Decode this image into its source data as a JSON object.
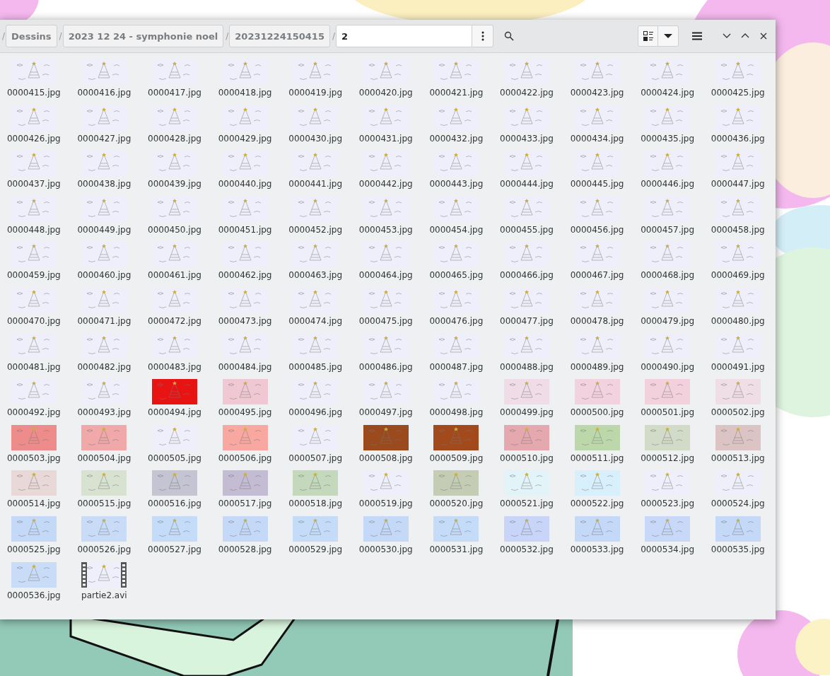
{
  "path": [
    {
      "separator": "/",
      "label": "Dessins",
      "selected": false
    },
    {
      "separator": "/",
      "label": "2023 12 24 - symphonie noel",
      "selected": false
    },
    {
      "separator": "/",
      "label": "20231224150415",
      "selected": false
    },
    {
      "separator": "/",
      "label": "2",
      "selected": true
    }
  ],
  "files": [
    {
      "name": "0000415.jpg",
      "kind": "image",
      "color": "#efeffb"
    },
    {
      "name": "0000416.jpg",
      "kind": "image",
      "color": "#efeffb"
    },
    {
      "name": "0000417.jpg",
      "kind": "image",
      "color": "#efeffb"
    },
    {
      "name": "0000418.jpg",
      "kind": "image",
      "color": "#efeffb"
    },
    {
      "name": "0000419.jpg",
      "kind": "image",
      "color": "#efeffb"
    },
    {
      "name": "0000420.jpg",
      "kind": "image",
      "color": "#efeffb"
    },
    {
      "name": "0000421.jpg",
      "kind": "image",
      "color": "#efeffb"
    },
    {
      "name": "0000422.jpg",
      "kind": "image",
      "color": "#efeffb"
    },
    {
      "name": "0000423.jpg",
      "kind": "image",
      "color": "#efeffb"
    },
    {
      "name": "0000424.jpg",
      "kind": "image",
      "color": "#efeffb"
    },
    {
      "name": "0000425.jpg",
      "kind": "image",
      "color": "#efeffb"
    },
    {
      "name": "0000426.jpg",
      "kind": "image",
      "color": "#efeffb"
    },
    {
      "name": "0000427.jpg",
      "kind": "image",
      "color": "#efeffb"
    },
    {
      "name": "0000428.jpg",
      "kind": "image",
      "color": "#efeffb"
    },
    {
      "name": "0000429.jpg",
      "kind": "image",
      "color": "#efeffb"
    },
    {
      "name": "0000430.jpg",
      "kind": "image",
      "color": "#efeffb"
    },
    {
      "name": "0000431.jpg",
      "kind": "image",
      "color": "#efeffb"
    },
    {
      "name": "0000432.jpg",
      "kind": "image",
      "color": "#efeffb"
    },
    {
      "name": "0000433.jpg",
      "kind": "image",
      "color": "#efeffb"
    },
    {
      "name": "0000434.jpg",
      "kind": "image",
      "color": "#efeffb"
    },
    {
      "name": "0000435.jpg",
      "kind": "image",
      "color": "#efeffb"
    },
    {
      "name": "0000436.jpg",
      "kind": "image",
      "color": "#efeffb"
    },
    {
      "name": "0000437.jpg",
      "kind": "image",
      "color": "#efeffb"
    },
    {
      "name": "0000438.jpg",
      "kind": "image",
      "color": "#efeffb"
    },
    {
      "name": "0000439.jpg",
      "kind": "image",
      "color": "#efeffb"
    },
    {
      "name": "0000440.jpg",
      "kind": "image",
      "color": "#efeffb"
    },
    {
      "name": "0000441.jpg",
      "kind": "image",
      "color": "#efeffb"
    },
    {
      "name": "0000442.jpg",
      "kind": "image",
      "color": "#efeffb"
    },
    {
      "name": "0000443.jpg",
      "kind": "image",
      "color": "#efeffb"
    },
    {
      "name": "0000444.jpg",
      "kind": "image",
      "color": "#efeffb"
    },
    {
      "name": "0000445.jpg",
      "kind": "image",
      "color": "#efeffb"
    },
    {
      "name": "0000446.jpg",
      "kind": "image",
      "color": "#efeffb"
    },
    {
      "name": "0000447.jpg",
      "kind": "image",
      "color": "#efeffb"
    },
    {
      "name": "0000448.jpg",
      "kind": "image",
      "color": "#efeffb"
    },
    {
      "name": "0000449.jpg",
      "kind": "image",
      "color": "#efeffb"
    },
    {
      "name": "0000450.jpg",
      "kind": "image",
      "color": "#efeffb"
    },
    {
      "name": "0000451.jpg",
      "kind": "image",
      "color": "#efeffb"
    },
    {
      "name": "0000452.jpg",
      "kind": "image",
      "color": "#efeffb"
    },
    {
      "name": "0000453.jpg",
      "kind": "image",
      "color": "#efeffb"
    },
    {
      "name": "0000454.jpg",
      "kind": "image",
      "color": "#efeffb"
    },
    {
      "name": "0000455.jpg",
      "kind": "image",
      "color": "#efeffb"
    },
    {
      "name": "0000456.jpg",
      "kind": "image",
      "color": "#efeffb"
    },
    {
      "name": "0000457.jpg",
      "kind": "image",
      "color": "#efeffb"
    },
    {
      "name": "0000458.jpg",
      "kind": "image",
      "color": "#efeffb"
    },
    {
      "name": "0000459.jpg",
      "kind": "image",
      "color": "#efeffb"
    },
    {
      "name": "0000460.jpg",
      "kind": "image",
      "color": "#efeffb"
    },
    {
      "name": "0000461.jpg",
      "kind": "image",
      "color": "#efeffb"
    },
    {
      "name": "0000462.jpg",
      "kind": "image",
      "color": "#efeffb"
    },
    {
      "name": "0000463.jpg",
      "kind": "image",
      "color": "#efeffb"
    },
    {
      "name": "0000464.jpg",
      "kind": "image",
      "color": "#efeffb"
    },
    {
      "name": "0000465.jpg",
      "kind": "image",
      "color": "#efeffb"
    },
    {
      "name": "0000466.jpg",
      "kind": "image",
      "color": "#efeffb"
    },
    {
      "name": "0000467.jpg",
      "kind": "image",
      "color": "#efeffb"
    },
    {
      "name": "0000468.jpg",
      "kind": "image",
      "color": "#efeffb"
    },
    {
      "name": "0000469.jpg",
      "kind": "image",
      "color": "#efeffb"
    },
    {
      "name": "0000470.jpg",
      "kind": "image",
      "color": "#efeffb"
    },
    {
      "name": "0000471.jpg",
      "kind": "image",
      "color": "#efeffb"
    },
    {
      "name": "0000472.jpg",
      "kind": "image",
      "color": "#efeffb"
    },
    {
      "name": "0000473.jpg",
      "kind": "image",
      "color": "#efeffb"
    },
    {
      "name": "0000474.jpg",
      "kind": "image",
      "color": "#efeffb"
    },
    {
      "name": "0000475.jpg",
      "kind": "image",
      "color": "#efeffb"
    },
    {
      "name": "0000476.jpg",
      "kind": "image",
      "color": "#efeffb"
    },
    {
      "name": "0000477.jpg",
      "kind": "image",
      "color": "#efeffb"
    },
    {
      "name": "0000478.jpg",
      "kind": "image",
      "color": "#efeffb"
    },
    {
      "name": "0000479.jpg",
      "kind": "image",
      "color": "#efeffb"
    },
    {
      "name": "0000480.jpg",
      "kind": "image",
      "color": "#efeffb"
    },
    {
      "name": "0000481.jpg",
      "kind": "image",
      "color": "#efeffb"
    },
    {
      "name": "0000482.jpg",
      "kind": "image",
      "color": "#efeffb"
    },
    {
      "name": "0000483.jpg",
      "kind": "image",
      "color": "#efeffb"
    },
    {
      "name": "0000484.jpg",
      "kind": "image",
      "color": "#efeffb"
    },
    {
      "name": "0000485.jpg",
      "kind": "image",
      "color": "#efeffb"
    },
    {
      "name": "0000486.jpg",
      "kind": "image",
      "color": "#efeffb"
    },
    {
      "name": "0000487.jpg",
      "kind": "image",
      "color": "#efeffb"
    },
    {
      "name": "0000488.jpg",
      "kind": "image",
      "color": "#efeffb"
    },
    {
      "name": "0000489.jpg",
      "kind": "image",
      "color": "#efeffb"
    },
    {
      "name": "0000490.jpg",
      "kind": "image",
      "color": "#efeffb"
    },
    {
      "name": "0000491.jpg",
      "kind": "image",
      "color": "#efeffb"
    },
    {
      "name": "0000492.jpg",
      "kind": "image",
      "color": "#efeffb"
    },
    {
      "name": "0000493.jpg",
      "kind": "image",
      "color": "#efeffb"
    },
    {
      "name": "0000494.jpg",
      "kind": "image",
      "color": "#e81414"
    },
    {
      "name": "0000495.jpg",
      "kind": "image",
      "color": "#f0c8d4"
    },
    {
      "name": "0000496.jpg",
      "kind": "image",
      "color": "#efeffb"
    },
    {
      "name": "0000497.jpg",
      "kind": "image",
      "color": "#efeffb"
    },
    {
      "name": "0000498.jpg",
      "kind": "image",
      "color": "#efeffb"
    },
    {
      "name": "0000499.jpg",
      "kind": "image",
      "color": "#f0dce6"
    },
    {
      "name": "0000500.jpg",
      "kind": "image",
      "color": "#f2d2de"
    },
    {
      "name": "0000501.jpg",
      "kind": "image",
      "color": "#f2d0dc"
    },
    {
      "name": "0000502.jpg",
      "kind": "image",
      "color": "#f0dee6"
    },
    {
      "name": "0000503.jpg",
      "kind": "image",
      "color": "#ee8c8c"
    },
    {
      "name": "0000504.jpg",
      "kind": "image",
      "color": "#f0a8a8"
    },
    {
      "name": "0000505.jpg",
      "kind": "image",
      "color": "#efeffb"
    },
    {
      "name": "0000506.jpg",
      "kind": "image",
      "color": "#f8a8a0"
    },
    {
      "name": "0000507.jpg",
      "kind": "image",
      "color": "#efeffb"
    },
    {
      "name": "0000508.jpg",
      "kind": "image",
      "color": "#9a4a1c"
    },
    {
      "name": "0000509.jpg",
      "kind": "image",
      "color": "#a24a1c"
    },
    {
      "name": "0000510.jpg",
      "kind": "image",
      "color": "#e4a8ae"
    },
    {
      "name": "0000511.jpg",
      "kind": "image",
      "color": "#bcd8aa"
    },
    {
      "name": "0000512.jpg",
      "kind": "image",
      "color": "#d2dac8"
    },
    {
      "name": "0000513.jpg",
      "kind": "image",
      "color": "#dcc4c4"
    },
    {
      "name": "0000514.jpg",
      "kind": "image",
      "color": "#e8d8d8"
    },
    {
      "name": "0000515.jpg",
      "kind": "image",
      "color": "#d8e2d0"
    },
    {
      "name": "0000516.jpg",
      "kind": "image",
      "color": "#c4c4d2"
    },
    {
      "name": "0000517.jpg",
      "kind": "image",
      "color": "#c4bcd2"
    },
    {
      "name": "0000518.jpg",
      "kind": "image",
      "color": "#c4d8bc"
    },
    {
      "name": "0000519.jpg",
      "kind": "image",
      "color": "#efeffb"
    },
    {
      "name": "0000520.jpg",
      "kind": "image",
      "color": "#c4ccb4"
    },
    {
      "name": "0000521.jpg",
      "kind": "image",
      "color": "#e2f4f8"
    },
    {
      "name": "0000522.jpg",
      "kind": "image",
      "color": "#d8f0fc"
    },
    {
      "name": "0000523.jpg",
      "kind": "image",
      "color": "#efeffb"
    },
    {
      "name": "0000524.jpg",
      "kind": "image",
      "color": "#efeffb"
    },
    {
      "name": "0000525.jpg",
      "kind": "image",
      "color": "#c4d8f8"
    },
    {
      "name": "0000526.jpg",
      "kind": "image",
      "color": "#c8dcf8"
    },
    {
      "name": "0000527.jpg",
      "kind": "image",
      "color": "#c4dcf8"
    },
    {
      "name": "0000528.jpg",
      "kind": "image",
      "color": "#c4d8f8"
    },
    {
      "name": "0000529.jpg",
      "kind": "image",
      "color": "#c4dcf8"
    },
    {
      "name": "0000530.jpg",
      "kind": "image",
      "color": "#c4d8f8"
    },
    {
      "name": "0000531.jpg",
      "kind": "image",
      "color": "#c4dcf8"
    },
    {
      "name": "0000532.jpg",
      "kind": "image",
      "color": "#c8d4f8"
    },
    {
      "name": "0000533.jpg",
      "kind": "image",
      "color": "#c4d8f8"
    },
    {
      "name": "0000534.jpg",
      "kind": "image",
      "color": "#c8d8f8"
    },
    {
      "name": "0000535.jpg",
      "kind": "image",
      "color": "#c4d8f8"
    },
    {
      "name": "0000536.jpg",
      "kind": "image",
      "color": "#c8dcf8"
    },
    {
      "name": "partie2.avi",
      "kind": "video",
      "color": "#efeffb"
    }
  ]
}
